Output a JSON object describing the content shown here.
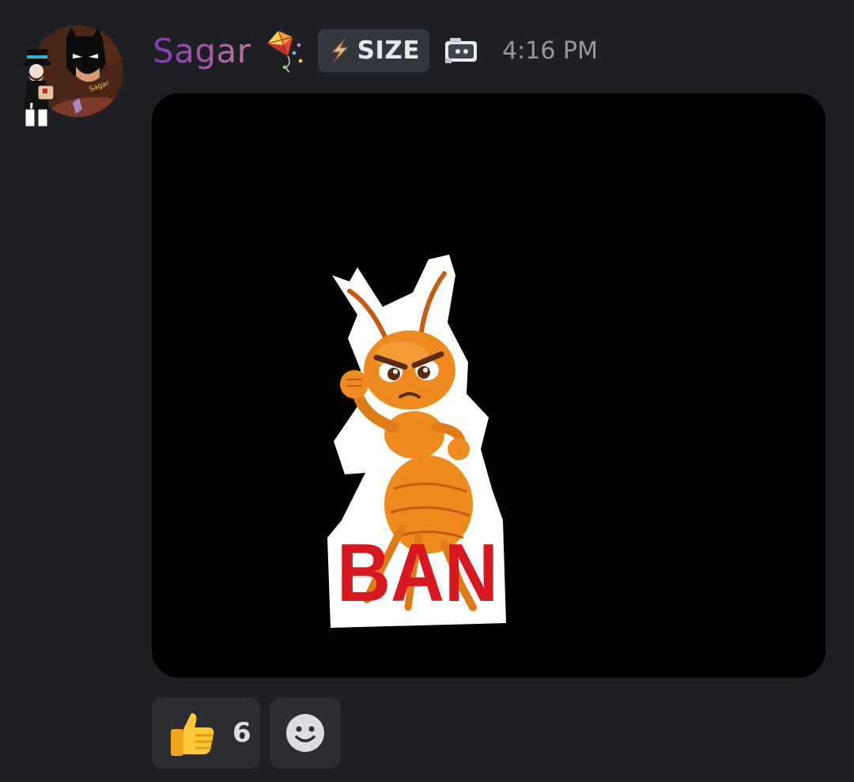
{
  "message": {
    "author": {
      "name": "Sagar",
      "name_gradient": [
        "#7d3bb5",
        "#b9799c"
      ],
      "avatar_icon": "batman-monopoly-avatar",
      "decoration_icon": "kite-icon"
    },
    "tag": {
      "icon": "lightning-icon",
      "label": "SIZE"
    },
    "badge_icon": "robot-icon",
    "timestamp": "4:16 PM",
    "attachment": {
      "sticker_text": "BAN",
      "sticker_icon": "angry-ant-sticker",
      "background": "#000000"
    },
    "reactions": [
      {
        "emoji": "thumbs-up-icon",
        "count": "6"
      }
    ],
    "add_reaction_icon": "smiley-icon"
  },
  "colors": {
    "background": "#1e1f25",
    "chip": "#2b2d33",
    "text_muted": "#96989e",
    "accent_red": "#d7191f",
    "ant_orange": "#ef8a1f"
  }
}
